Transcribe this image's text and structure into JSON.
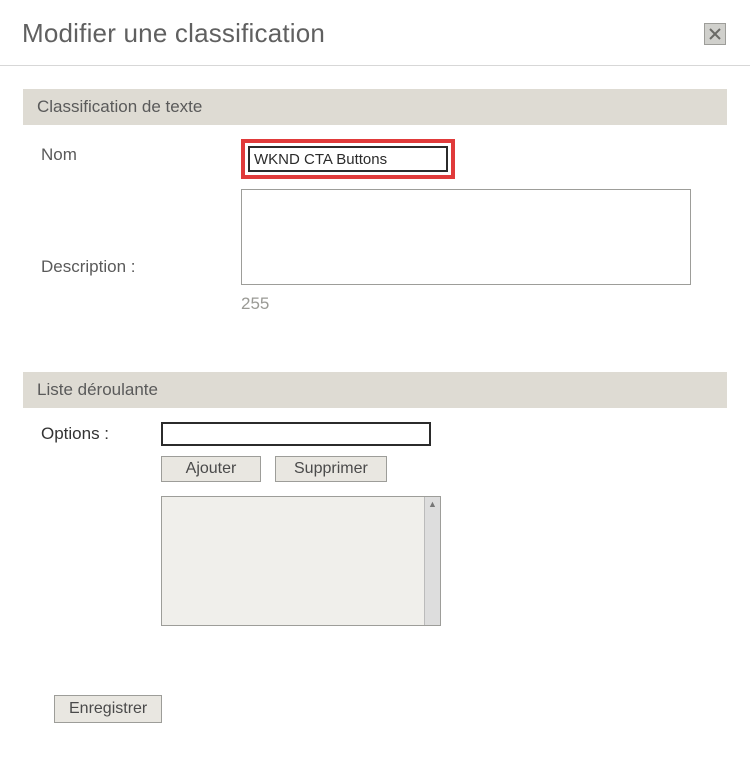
{
  "dialog": {
    "title": "Modifier une classification"
  },
  "sections": {
    "textClassification": {
      "header": "Classification de texte",
      "nameLabel": "Nom",
      "nameValue": "WKND CTA Buttons",
      "descLabel": "Description :",
      "descValue": "",
      "charCount": "255"
    },
    "dropdown": {
      "header": "Liste déroulante",
      "optionsLabel": "Options :",
      "optionsValue": "",
      "addLabel": "Ajouter",
      "removeLabel": "Supprimer"
    }
  },
  "footer": {
    "saveLabel": "Enregistrer"
  }
}
